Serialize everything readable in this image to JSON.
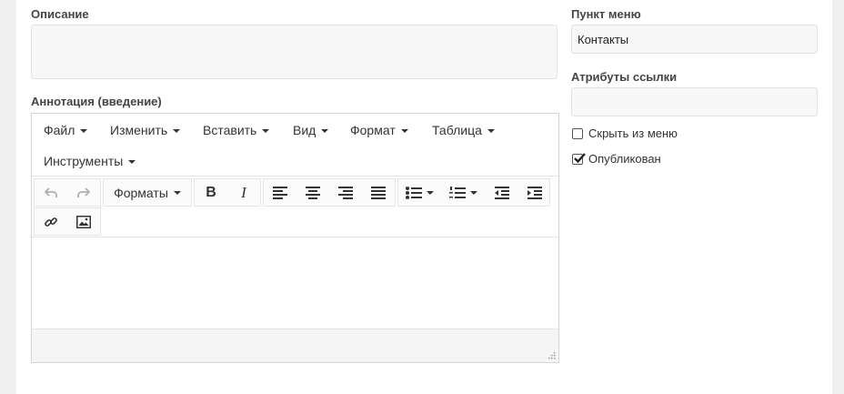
{
  "description": {
    "label": "Описание",
    "value": ""
  },
  "annotation": {
    "label": "Аннотация (введение)",
    "menus": [
      {
        "label": "Файл"
      },
      {
        "label": "Изменить"
      },
      {
        "label": "Вставить"
      },
      {
        "label": "Вид"
      },
      {
        "label": "Формат"
      },
      {
        "label": "Таблица"
      },
      {
        "label": "Инструменты"
      }
    ],
    "toolbar": {
      "formats_label": "Форматы",
      "bold_label": "B",
      "italic_label": "I",
      "icons": [
        "undo-icon",
        "redo-icon",
        "align-left-icon",
        "align-center-icon",
        "align-right-icon",
        "align-justify-icon",
        "bullet-list-icon",
        "numbered-list-icon",
        "outdent-icon",
        "indent-icon",
        "link-icon",
        "image-icon"
      ]
    },
    "content": ""
  },
  "menu_item": {
    "label": "Пункт меню",
    "value": "Контакты"
  },
  "link_attributes": {
    "label": "Атрибуты ссылки",
    "value": ""
  },
  "hide_from_menu": {
    "label": "Скрыть из меню",
    "checked": false
  },
  "published": {
    "label": "Опубликован",
    "checked": true
  }
}
